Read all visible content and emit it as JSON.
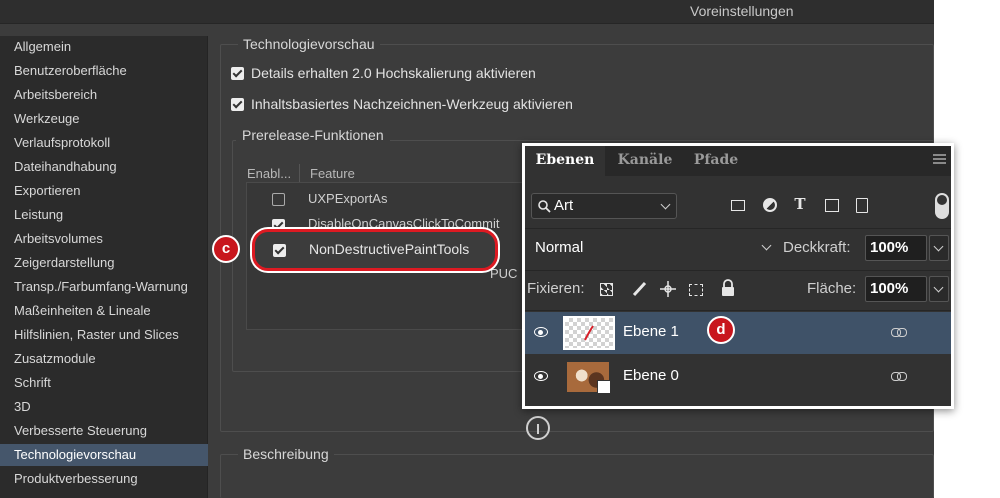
{
  "window": {
    "title": "Voreinstellungen"
  },
  "sidebar": {
    "items": [
      {
        "label": "Allgemein"
      },
      {
        "label": "Benutzeroberfläche"
      },
      {
        "label": "Arbeitsbereich"
      },
      {
        "label": "Werkzeuge"
      },
      {
        "label": "Verlaufsprotokoll"
      },
      {
        "label": "Dateihandhabung"
      },
      {
        "label": "Exportieren"
      },
      {
        "label": "Leistung"
      },
      {
        "label": "Arbeitsvolumes"
      },
      {
        "label": "Zeigerdarstellung"
      },
      {
        "label": "Transp./Farbumfang-Warnung"
      },
      {
        "label": "Maßeinheiten & Lineale"
      },
      {
        "label": "Hilfslinien, Raster und Slices"
      },
      {
        "label": "Zusatzmodule"
      },
      {
        "label": "Schrift"
      },
      {
        "label": "3D"
      },
      {
        "label": "Verbesserte Steuerung"
      },
      {
        "label": "Technologievorschau",
        "selected": true
      },
      {
        "label": "Produktverbesserung"
      }
    ]
  },
  "tech": {
    "title": "Technologievorschau",
    "options": [
      {
        "label": "Details erhalten 2.0 Hochskalierung aktivieren",
        "checked": true
      },
      {
        "label": "Inhaltsbasiertes Nachzeichnen-Werkzeug aktivieren",
        "checked": true
      }
    ],
    "prerelease": {
      "title": "Prerelease-Funktionen",
      "col_enabled": "Enabl...",
      "col_feature": "Feature",
      "rows": [
        {
          "feature": "UXPExportAs",
          "enabled": false
        },
        {
          "feature": "DisableOnCanvasClickToCommit",
          "enabled": true
        },
        {
          "feature": "NonDestructivePaintTools",
          "enabled": true
        },
        {
          "feature": "",
          "partial": "PUC"
        }
      ]
    },
    "description_title": "Beschreibung"
  },
  "callouts": {
    "c": "c",
    "d": "d"
  },
  "layers_panel": {
    "tabs": [
      {
        "label": "Ebenen",
        "active": true
      },
      {
        "label": "Kanäle"
      },
      {
        "label": "Pfade"
      }
    ],
    "filter": {
      "label": "Art",
      "icon": "search-icon"
    },
    "filter_icons": [
      "image-icon",
      "adjustment-icon",
      "text-icon",
      "shape-icon",
      "smart-object-icon"
    ],
    "blend_mode": "Normal",
    "opacity_label": "Deckkraft:",
    "opacity_value": "100%",
    "lock_label": "Fixieren:",
    "lock_icons": [
      "lock-transparent-icon",
      "lock-paint-icon",
      "lock-move-icon",
      "lock-artboard-icon",
      "lock-all-icon"
    ],
    "fill_label": "Fläche:",
    "fill_value": "100%",
    "layers": [
      {
        "name": "Ebene 1",
        "selected": true
      },
      {
        "name": "Ebene 0",
        "selected": false
      }
    ]
  },
  "colors": {
    "accent_red": "#dd1a22",
    "selection_blue": "#45566b"
  }
}
